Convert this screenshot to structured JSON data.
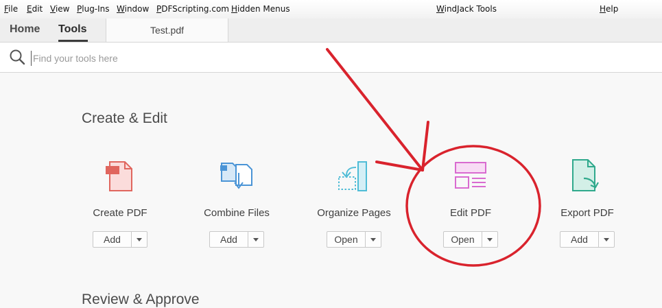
{
  "menu": [
    "File",
    "Edit",
    "View",
    "Plug-Ins",
    "Window",
    "PDFScripting.com",
    "Hidden Menus",
    "WindJack Tools",
    "Help"
  ],
  "tabs": {
    "home": "Home",
    "tools": "Tools"
  },
  "document_tab": "Test.pdf",
  "search": {
    "placeholder": "Find your tools here"
  },
  "sections": {
    "create_edit": "Create & Edit",
    "review_approve": "Review & Approve"
  },
  "tools": [
    {
      "label": "Create PDF",
      "button": "Add",
      "icon": "create-pdf-icon",
      "color": "#e0665e"
    },
    {
      "label": "Combine Files",
      "button": "Add",
      "icon": "combine-files-icon",
      "color": "#4a94d6"
    },
    {
      "label": "Organize Pages",
      "button": "Open",
      "icon": "organize-pages-icon",
      "color": "#4fbcd6"
    },
    {
      "label": "Edit PDF",
      "button": "Open",
      "icon": "edit-pdf-icon",
      "color": "#d96bd0"
    },
    {
      "label": "Export PDF",
      "button": "Add",
      "icon": "export-pdf-icon",
      "color": "#2fa98c"
    }
  ],
  "annotation_color": "#d9232d"
}
